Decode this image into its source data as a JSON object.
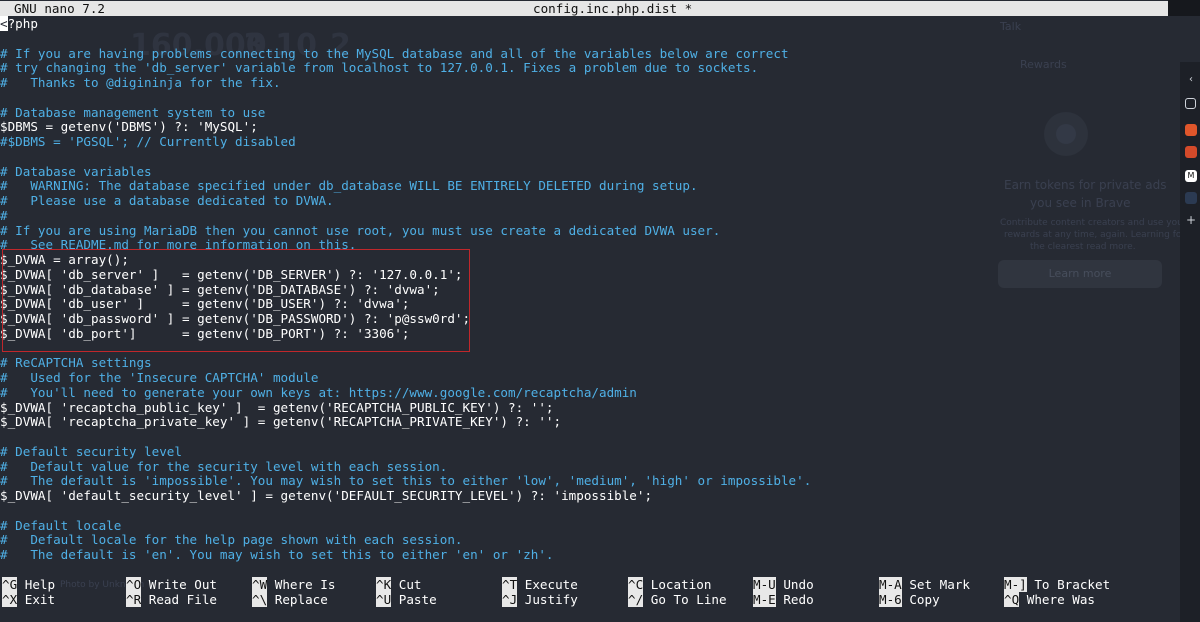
{
  "titlebar": {
    "app": "GNU nano 7.2",
    "file": "config.inc.php.dist *"
  },
  "editor": {
    "lines": [
      {
        "text": "<?php",
        "type": "code"
      },
      {
        "text": "",
        "type": "code"
      },
      {
        "text": "# If you are having problems connecting to the MySQL database and all of the variables below are correct",
        "type": "comment"
      },
      {
        "text": "# try changing the 'db_server' variable from localhost to 127.0.0.1. Fixes a problem due to sockets.",
        "type": "comment"
      },
      {
        "text": "#   Thanks to @digininja for the fix.",
        "type": "comment"
      },
      {
        "text": "",
        "type": "code"
      },
      {
        "text": "# Database management system to use",
        "type": "comment"
      },
      {
        "text": "$DBMS = getenv('DBMS') ?: 'MySQL';",
        "type": "code"
      },
      {
        "text": "#$DBMS = 'PGSQL'; // Currently disabled",
        "type": "comment"
      },
      {
        "text": "",
        "type": "code"
      },
      {
        "text": "# Database variables",
        "type": "comment"
      },
      {
        "text": "#   WARNING: The database specified under db_database WILL BE ENTIRELY DELETED during setup.",
        "type": "comment"
      },
      {
        "text": "#   Please use a database dedicated to DVWA.",
        "type": "comment"
      },
      {
        "text": "#",
        "type": "comment"
      },
      {
        "text": "# If you are using MariaDB then you cannot use root, you must use create a dedicated DVWA user.",
        "type": "comment"
      },
      {
        "text": "#   See README.md for more information on this.",
        "type": "comment"
      },
      {
        "text": "$_DVWA = array();",
        "type": "code"
      },
      {
        "text": "$_DVWA[ 'db_server' ]   = getenv('DB_SERVER') ?: '127.0.0.1';",
        "type": "code"
      },
      {
        "text": "$_DVWA[ 'db_database' ] = getenv('DB_DATABASE') ?: 'dvwa';",
        "type": "code"
      },
      {
        "text": "$_DVWA[ 'db_user' ]     = getenv('DB_USER') ?: 'dvwa';",
        "type": "code"
      },
      {
        "text": "$_DVWA[ 'db_password' ] = getenv('DB_PASSWORD') ?: 'p@ssw0rd';",
        "type": "code"
      },
      {
        "text": "$_DVWA[ 'db_port']      = getenv('DB_PORT') ?: '3306';",
        "type": "code"
      },
      {
        "text": "",
        "type": "code"
      },
      {
        "text": "# ReCAPTCHA settings",
        "type": "comment"
      },
      {
        "text": "#   Used for the 'Insecure CAPTCHA' module",
        "type": "comment"
      },
      {
        "text": "#   You'll need to generate your own keys at: https://www.google.com/recaptcha/admin",
        "type": "comment"
      },
      {
        "text": "$_DVWA[ 'recaptcha_public_key' ]  = getenv('RECAPTCHA_PUBLIC_KEY') ?: '';",
        "type": "code"
      },
      {
        "text": "$_DVWA[ 'recaptcha_private_key' ] = getenv('RECAPTCHA_PRIVATE_KEY') ?: '';",
        "type": "code"
      },
      {
        "text": "",
        "type": "code"
      },
      {
        "text": "# Default security level",
        "type": "comment"
      },
      {
        "text": "#   Default value for the security level with each session.",
        "type": "comment"
      },
      {
        "text": "#   The default is 'impossible'. You may wish to set this to either 'low', 'medium', 'high' or impossible'.",
        "type": "comment"
      },
      {
        "text": "$_DVWA[ 'default_security_level' ] = getenv('DEFAULT_SECURITY_LEVEL') ?: 'impossible';",
        "type": "code"
      },
      {
        "text": "",
        "type": "code"
      },
      {
        "text": "# Default locale",
        "type": "comment"
      },
      {
        "text": "#   Default locale for the help page shown with each session.",
        "type": "comment"
      },
      {
        "text": "#   The default is 'en'. You may wish to set this to either 'en' or 'zh'.",
        "type": "comment"
      }
    ]
  },
  "shortcuts": [
    {
      "key": "^G",
      "label": "Help"
    },
    {
      "key": "^X",
      "label": "Exit"
    },
    {
      "key": "^O",
      "label": "Write Out"
    },
    {
      "key": "^R",
      "label": "Read File"
    },
    {
      "key": "^W",
      "label": "Where Is"
    },
    {
      "key": "^\\",
      "label": "Replace"
    },
    {
      "key": "^K",
      "label": "Cut"
    },
    {
      "key": "^U",
      "label": "Paste"
    },
    {
      "key": "^T",
      "label": "Execute"
    },
    {
      "key": "^J",
      "label": "Justify"
    },
    {
      "key": "^C",
      "label": "Location"
    },
    {
      "key": "^/",
      "label": "Go To Line"
    },
    {
      "key": "M-U",
      "label": "Undo"
    },
    {
      "key": "M-E",
      "label": "Redo"
    },
    {
      "key": "M-A",
      "label": "Set Mark"
    },
    {
      "key": "M-6",
      "label": "Copy"
    },
    {
      "key": "M-]",
      "label": "To Bracket"
    },
    {
      "key": "^Q",
      "label": "Where Was"
    }
  ],
  "background": {
    "numbers": [
      "160,000",
      "3.10",
      "2"
    ],
    "talk_label": "Talk",
    "rewards_label": "Rewards",
    "earn_title_1": "Earn tokens for private ads",
    "earn_title_2": "you see in Brave",
    "earn_desc_1": "Contribute content creators and use your",
    "earn_desc_2": "rewards at any time, again. Learning for",
    "earn_desc_3": "the clearest read more.",
    "learn_more": "Learn more",
    "footer_left": "Photo by Unknown"
  },
  "colors": {
    "comment": "#4fb0e6",
    "code": "#ffffff",
    "highlight_border": "#c0272b",
    "background": "#262a33"
  }
}
